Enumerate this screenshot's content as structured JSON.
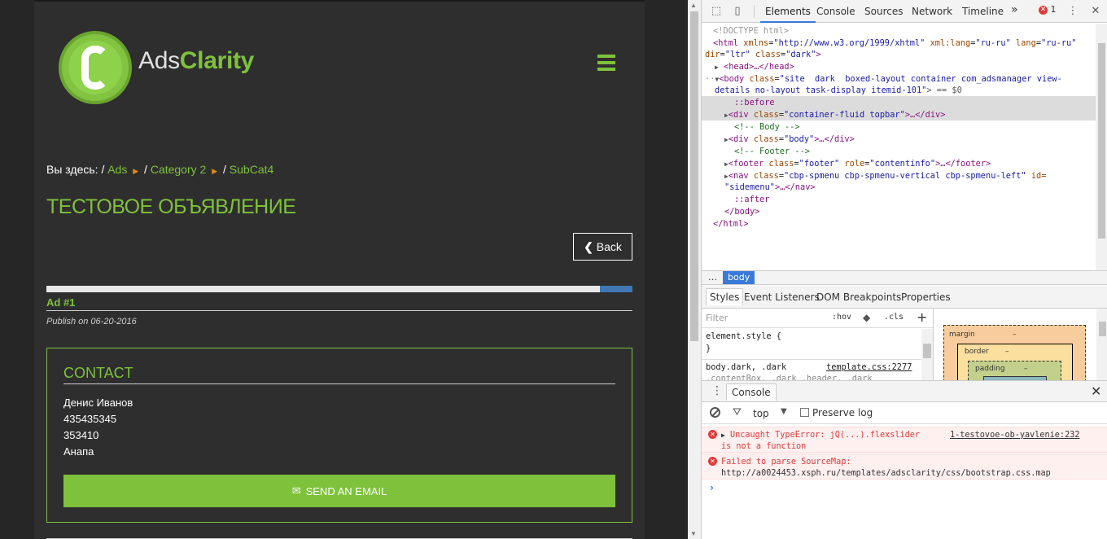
{
  "site": {
    "brand_plain": "Ads",
    "brand_bold": "Clarity",
    "logo_letter": "C",
    "breadcrumb": {
      "label": "Вы здесь:",
      "items": [
        "Ads",
        "Category 2",
        "SubCat4"
      ]
    },
    "page_title": "ТЕСТОВОЕ ОБЪЯВЛЕНИЕ",
    "back_label": "Back",
    "ad_number": "Ad #1",
    "publish": "Publish on 06-20-2016",
    "contact": {
      "title": "CONTACT",
      "lines": [
        "Денис Иванов",
        "435435345",
        "353410",
        "Анапа"
      ],
      "email_button": "SEND AN EMAIL"
    },
    "colors": {
      "accent": "#7ec23b",
      "background": "#2e2e2e"
    }
  },
  "devtools": {
    "tabs": [
      "Elements",
      "Console",
      "Sources",
      "Network",
      "Timeline"
    ],
    "more": "»",
    "error_count": "1",
    "dom": {
      "doctype": "<!DOCTYPE html>",
      "html_open_1a": "<html ",
      "html_attr_xmlns": "xmlns",
      "html_val_xmlns": "\"http://www.w3.org/1999/xhtml\"",
      "html_attr_xmllang": "xml:lang",
      "html_val_xmllang": "\"ru-ru\"",
      "html_attr_lang": "lang",
      "html_val_lang": "\"ru-ru\"",
      "html_attr_dir": "dir",
      "html_val_dir": "\"ltr\"",
      "html_attr_class": "class",
      "html_val_class": "\"dark\"",
      "head": "<head>…</head>",
      "body_tag": "<body ",
      "body_attr_class": "class",
      "body_val_class_1": "\"site  dark  boxed-layout container com_adsmanager view-",
      "body_val_class_2": "details no-layout task-display itemid-101\"",
      "body_eq": "> == $0",
      "before": "::before",
      "div_topbar_open": "<div ",
      "div_topbar_attr": "class",
      "div_topbar_val": "\"container-fluid topbar\"",
      "div_topbar_close": ">…</div>",
      "comment_body": "<!-- Body -->",
      "div_body_open": "<div ",
      "div_body_attr": "class",
      "div_body_val": "\"body\"",
      "div_body_close": ">…</div>",
      "comment_footer": "<!-- Footer -->",
      "footer_open": "<footer ",
      "footer_attr_class": "class",
      "footer_val_class": "\"footer\"",
      "footer_attr_role": "role",
      "footer_val_role": "\"contentinfo\"",
      "footer_close": ">…</footer>",
      "nav_open": "<nav ",
      "nav_attr_class": "class",
      "nav_val_class": "\"cbp-spmenu cbp-spmenu-vertical cbp-spmenu-left\"",
      "nav_attr_id": "id=",
      "nav_val_id": "\"sidemenu\"",
      "nav_close": ">…</nav>",
      "after": "::after",
      "body_close": "</body>",
      "html_close": "</html>"
    },
    "crumb_dots": "…",
    "crumb_body": "body",
    "styles_tabs": [
      "Styles",
      "Event Listeners",
      "DOM Breakpoints",
      "Properties"
    ],
    "filter_placeholder": "Filter",
    "hov": ":hov",
    "cls": ".cls",
    "rules": {
      "element_style": "element.style {",
      "close_brace": "}",
      "selector": "body.dark, .dark",
      "source": "template.css:2277",
      "selector2": ".contentBox, .dark .header, .dark"
    },
    "boxmodel": {
      "margin": "margin",
      "border": "border",
      "padding": "padding",
      "dash": "–"
    },
    "console": {
      "tab": "Console",
      "context": "top",
      "preserve_log": "Preserve log",
      "messages": [
        {
          "text1": "Uncaught TypeError: jQ(...).flexslider",
          "text2": "is not a function",
          "source": "1-testovoe-ob-yavlenie:232"
        },
        {
          "text1": "Failed to parse SourceMap:",
          "text2": "http://a0024453.xsph.ru/templates/adsclarity/css/bootstrap.css.map"
        }
      ],
      "prompt": "›"
    }
  }
}
